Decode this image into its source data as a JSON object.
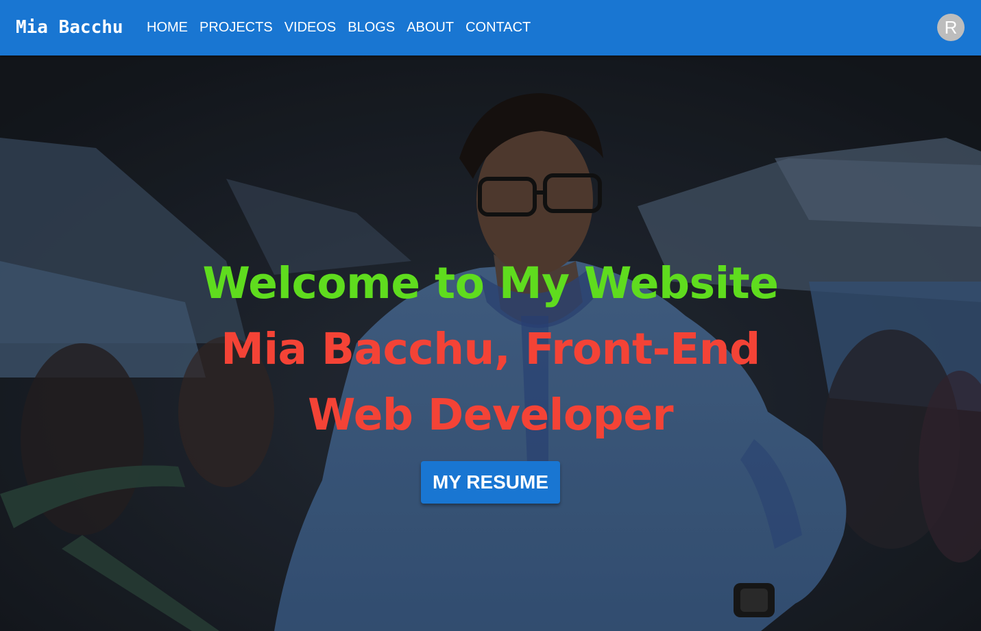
{
  "navbar": {
    "brand": "Mia Bacchu",
    "links": [
      "HOME",
      "PROJECTS",
      "VIDEOS",
      "BLOGS",
      "ABOUT",
      "CONTACT"
    ],
    "avatar_letter": "R"
  },
  "hero": {
    "welcome": "Welcome to My Website",
    "subtitle": "Mia Bacchu, Front-End Web Developer",
    "button_label": "MY RESUME"
  },
  "colors": {
    "navbar": "#1976d2",
    "welcome": "#5fdc1e",
    "subtitle": "#f44336",
    "button": "#1976d2",
    "avatar": "#bdbdbd"
  }
}
